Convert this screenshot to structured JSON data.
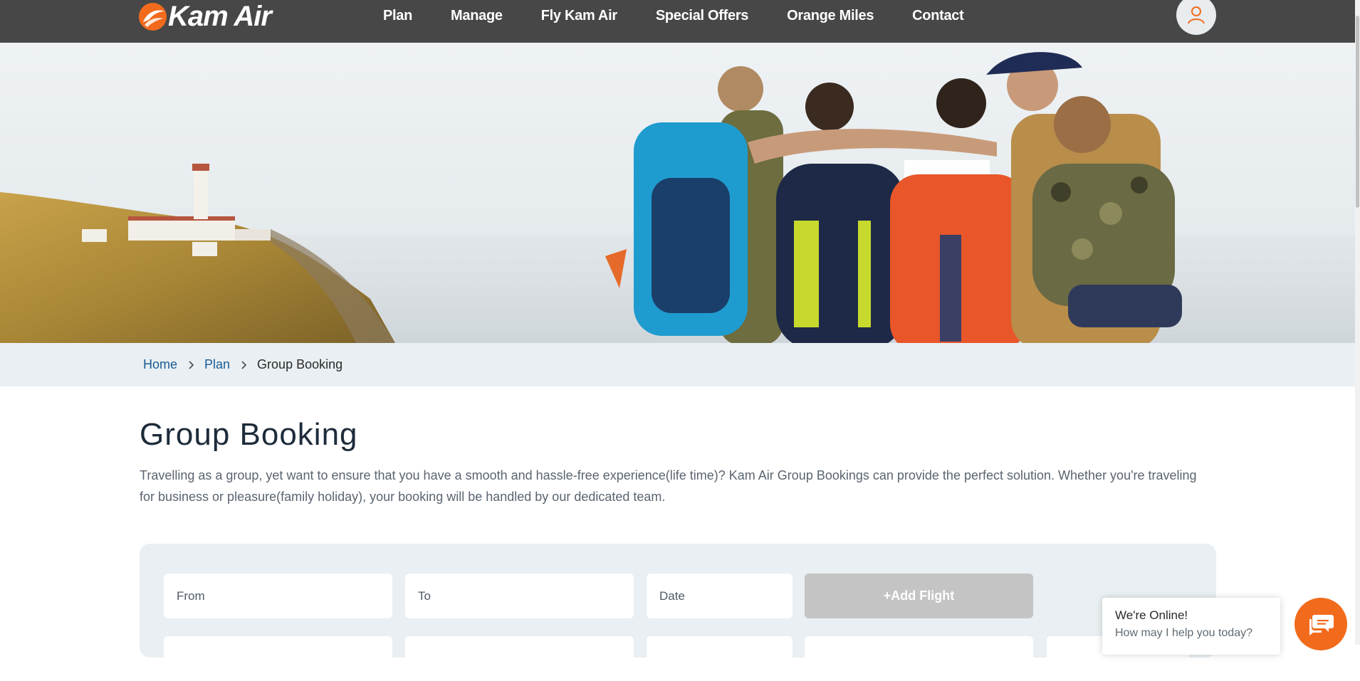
{
  "header": {
    "logo_text": "Kam Air",
    "nav": [
      "Plan",
      "Manage",
      "Fly Kam Air",
      "Special Offers",
      "Orange Miles",
      "Contact"
    ],
    "user_icon": "user-icon"
  },
  "breadcrumb": {
    "items": [
      "Home",
      "Plan"
    ],
    "current": "Group Booking"
  },
  "main": {
    "title": "Group Booking",
    "intro": "Travelling as a group, yet want to ensure that you have a smooth and hassle-free experience(life time)? Kam Air Group Bookings can provide the perfect solution. Whether you're traveling for business or pleasure(family holiday), your booking will be handled by our dedicated team."
  },
  "form": {
    "from_placeholder": "From",
    "to_placeholder": "To",
    "date_placeholder": "Date",
    "add_flight_label": "+Add Flight"
  },
  "chat": {
    "title": "We're Online!",
    "subtitle": "How may I help you today?",
    "icon": "chat-icon"
  },
  "colors": {
    "header_bg": "#474747",
    "brand_orange": "#f26b1d",
    "breadcrumb_bg": "#e9eff2",
    "link_blue": "#1a5c96",
    "disabled_button": "#c4c4c4"
  }
}
